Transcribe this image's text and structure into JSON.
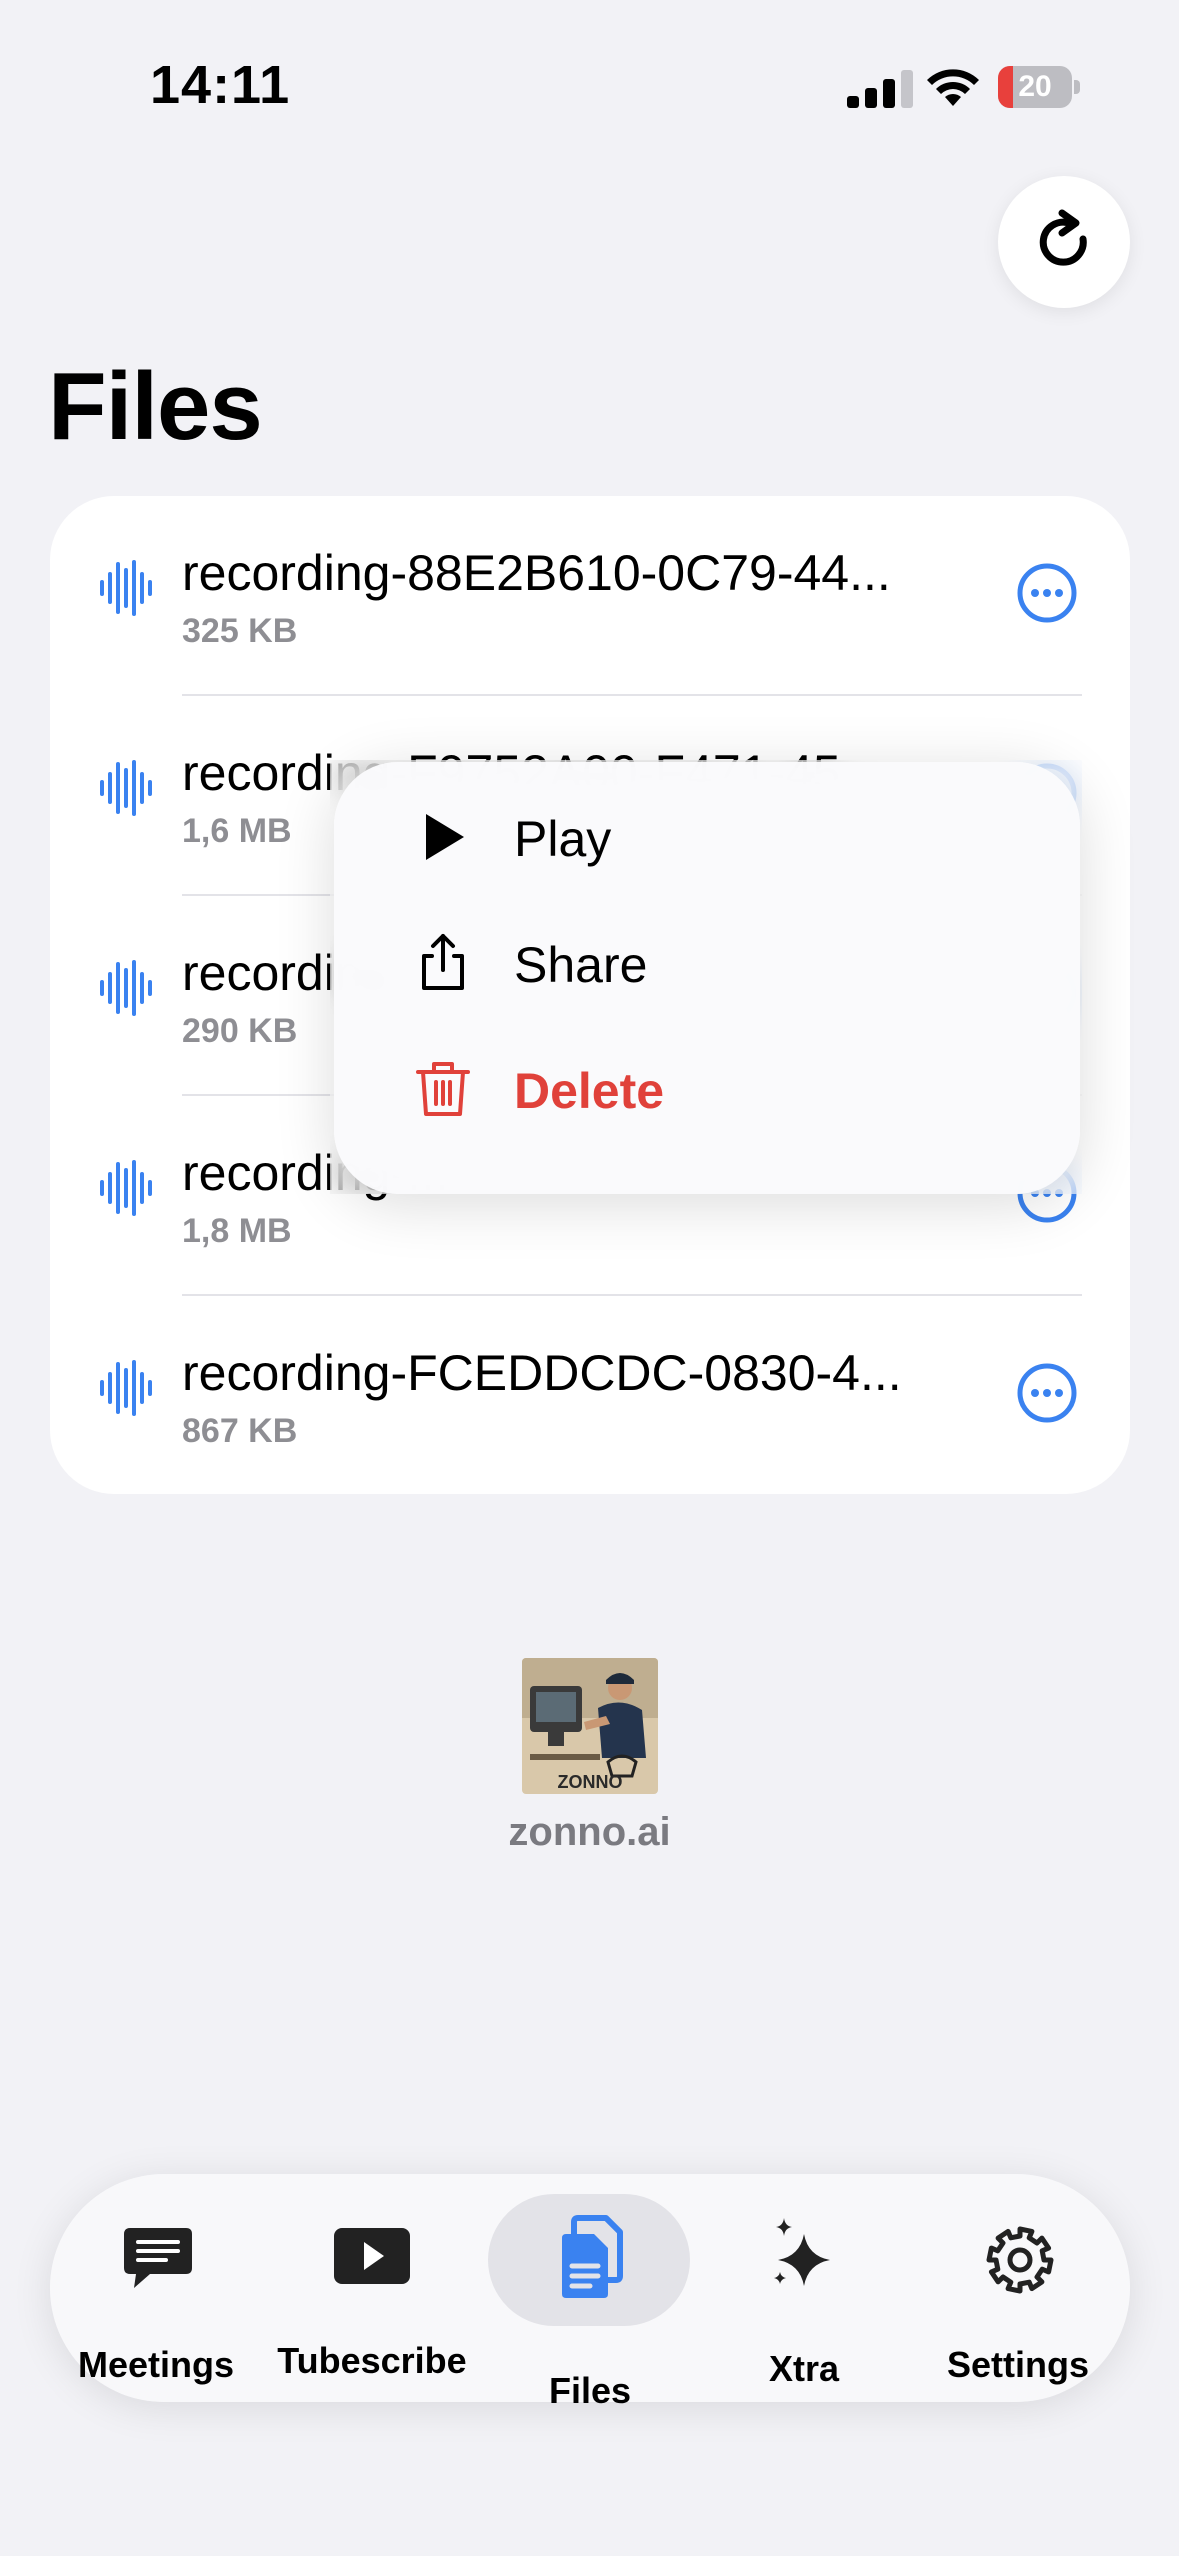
{
  "status_bar": {
    "time": "14:11",
    "battery_level": "20",
    "battery_fraction": 0.2
  },
  "header": {
    "title": "Files",
    "refresh_icon": "refresh-icon"
  },
  "files": [
    {
      "name": "recording-88E2B610-0C79-44...",
      "size": "325 KB"
    },
    {
      "name": "recording-F9752A00-F471-45...",
      "size": "1,6 MB"
    },
    {
      "name": "recording-...",
      "size": "290 KB"
    },
    {
      "name": "recording-...",
      "size": "1,8 MB"
    },
    {
      "name": "recording-FCEDDCDC-0830-4...",
      "size": "867 KB"
    }
  ],
  "context_menu": {
    "items": [
      {
        "label": "Play",
        "icon": "play-icon"
      },
      {
        "label": "Share",
        "icon": "share-icon"
      },
      {
        "label": "Delete",
        "icon": "trash-icon",
        "destructive": true
      }
    ]
  },
  "brand": {
    "logo_text": "ZONNO",
    "name": "zonno.ai"
  },
  "tab_bar": {
    "tabs": [
      {
        "label": "Meetings",
        "icon": "chat-bubble-icon"
      },
      {
        "label": "Tubescribe",
        "icon": "play-rectangle-icon"
      },
      {
        "label": "Files",
        "icon": "documents-icon",
        "selected": true
      },
      {
        "label": "Xtra",
        "icon": "sparkles-icon"
      },
      {
        "label": "Settings",
        "icon": "gear-icon"
      }
    ]
  },
  "colors": {
    "accent": "#3a82f0",
    "destructive": "#e0413a",
    "background": "#f2f2f6",
    "secondary_text": "#8e8e93"
  }
}
